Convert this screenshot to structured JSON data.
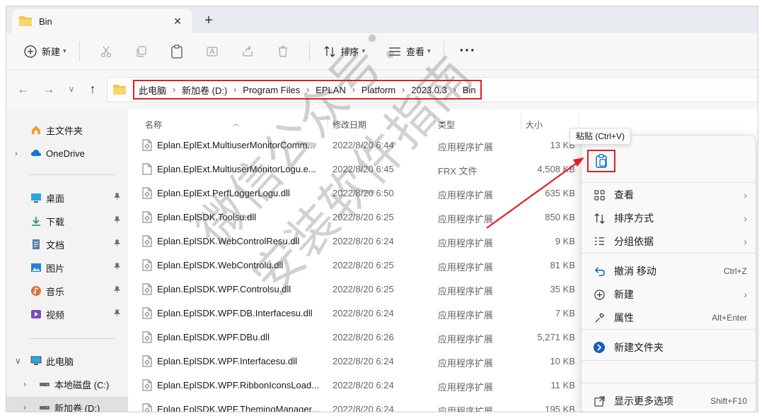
{
  "window": {
    "tab_title": "Bin",
    "tab_close": "✕",
    "new_tab": "+"
  },
  "toolbar": {
    "new_label": "新建",
    "sort_label": "排序",
    "view_label": "查看",
    "more_label": "···"
  },
  "address": {
    "crumbs": [
      "此电脑",
      "新加卷 (D:)",
      "Program Files",
      "EPLAN",
      "Platform",
      "2023.0.3",
      "Bin"
    ],
    "separator": "›"
  },
  "nav": {
    "back": "←",
    "forward": "→",
    "recent": "∨",
    "up": "↑"
  },
  "sidebar": {
    "items": [
      {
        "label": "主文件夹",
        "icon": "home-icon"
      },
      {
        "label": "OneDrive",
        "icon": "cloud-icon"
      },
      {
        "label": "桌面",
        "icon": "desktop-icon",
        "pinned": true
      },
      {
        "label": "下载",
        "icon": "download-icon",
        "pinned": true
      },
      {
        "label": "文档",
        "icon": "document-icon",
        "pinned": true
      },
      {
        "label": "图片",
        "icon": "picture-icon",
        "pinned": true
      },
      {
        "label": "音乐",
        "icon": "music-icon",
        "pinned": true
      },
      {
        "label": "视频",
        "icon": "video-icon",
        "pinned": true
      },
      {
        "label": "此电脑",
        "icon": "computer-icon"
      },
      {
        "label": "本地磁盘 (C:)",
        "icon": "drive-icon"
      },
      {
        "label": "新加卷 (D:)",
        "icon": "drive-icon"
      }
    ]
  },
  "columns": {
    "name": "名称",
    "modified": "修改日期",
    "type": "类型",
    "size": "大小"
  },
  "files": [
    {
      "name": "Eplan.EplExt.MultiuserMonitorComm...",
      "date": "2022/8/20 6:44",
      "type": "应用程序扩展",
      "size": "13 KB"
    },
    {
      "name": "Eplan.EplExt.MultiuserMonitorLogu.e...",
      "date": "2022/8/20 6:45",
      "type": "FRX 文件",
      "size": "4,508 KB"
    },
    {
      "name": "Eplan.EplExt.PerfLoggerLogu.dll",
      "date": "2022/8/20 6:50",
      "type": "应用程序扩展",
      "size": "635 KB"
    },
    {
      "name": "Eplan.EplSDK.Toolsu.dll",
      "date": "2022/8/20 6:25",
      "type": "应用程序扩展",
      "size": "850 KB"
    },
    {
      "name": "Eplan.EplSDK.WebControlResu.dll",
      "date": "2022/8/20 6:24",
      "type": "应用程序扩展",
      "size": "9 KB"
    },
    {
      "name": "Eplan.EplSDK.WebControlu.dll",
      "date": "2022/8/20 6:25",
      "type": "应用程序扩展",
      "size": "81 KB"
    },
    {
      "name": "Eplan.EplSDK.WPF.Controlsu.dll",
      "date": "2022/8/20 6:25",
      "type": "应用程序扩展",
      "size": "35 KB"
    },
    {
      "name": "Eplan.EplSDK.WPF.DB.Interfacesu.dll",
      "date": "2022/8/20 6:24",
      "type": "应用程序扩展",
      "size": "7 KB"
    },
    {
      "name": "Eplan.EplSDK.WPF.DBu.dll",
      "date": "2022/8/20 6:26",
      "type": "应用程序扩展",
      "size": "5,271 KB"
    },
    {
      "name": "Eplan.EplSDK.WPF.Interfacesu.dll",
      "date": "2022/8/20 6:24",
      "type": "应用程序扩展",
      "size": "10 KB"
    },
    {
      "name": "Eplan.EplSDK.WPF.RibbonIconsLoad...",
      "date": "2022/8/20 6:24",
      "type": "应用程序扩展",
      "size": "11 KB"
    },
    {
      "name": "Eplan.EplSDK.WPF.ThemingManager...",
      "date": "2022/8/20 6:24",
      "type": "应用程序扩展",
      "size": "195 KB"
    }
  ],
  "context_menu": {
    "paste_tooltip": "粘贴 (Ctrl+V)",
    "items": [
      {
        "label": "查看",
        "icon": "grid-icon",
        "shortcut": "",
        "submenu": true
      },
      {
        "label": "排序方式",
        "icon": "sort-icon",
        "shortcut": "",
        "submenu": true
      },
      {
        "label": "分组依据",
        "icon": "group-icon",
        "shortcut": "",
        "submenu": true
      },
      {
        "label": "撤消 移动",
        "icon": "undo-icon",
        "shortcut": "Ctrl+Z",
        "submenu": false
      },
      {
        "label": "新建",
        "icon": "new-icon",
        "shortcut": "",
        "submenu": true
      },
      {
        "label": "属性",
        "icon": "wrench-icon",
        "shortcut": "Alt+Enter",
        "submenu": false
      },
      {
        "label": "新建文件夹",
        "icon": "new-folder-icon",
        "shortcut": "",
        "submenu": false
      },
      {
        "label": "显示更多选项",
        "icon": "more-options-icon",
        "shortcut": "Shift+F10",
        "submenu": false
      }
    ]
  },
  "watermark": [
    "微信公众号：",
    "安装软件指南"
  ],
  "colors": {
    "highlight_red": "#e02020",
    "folder_yellow": "#f6c244",
    "accent_blue": "#0067c0"
  }
}
